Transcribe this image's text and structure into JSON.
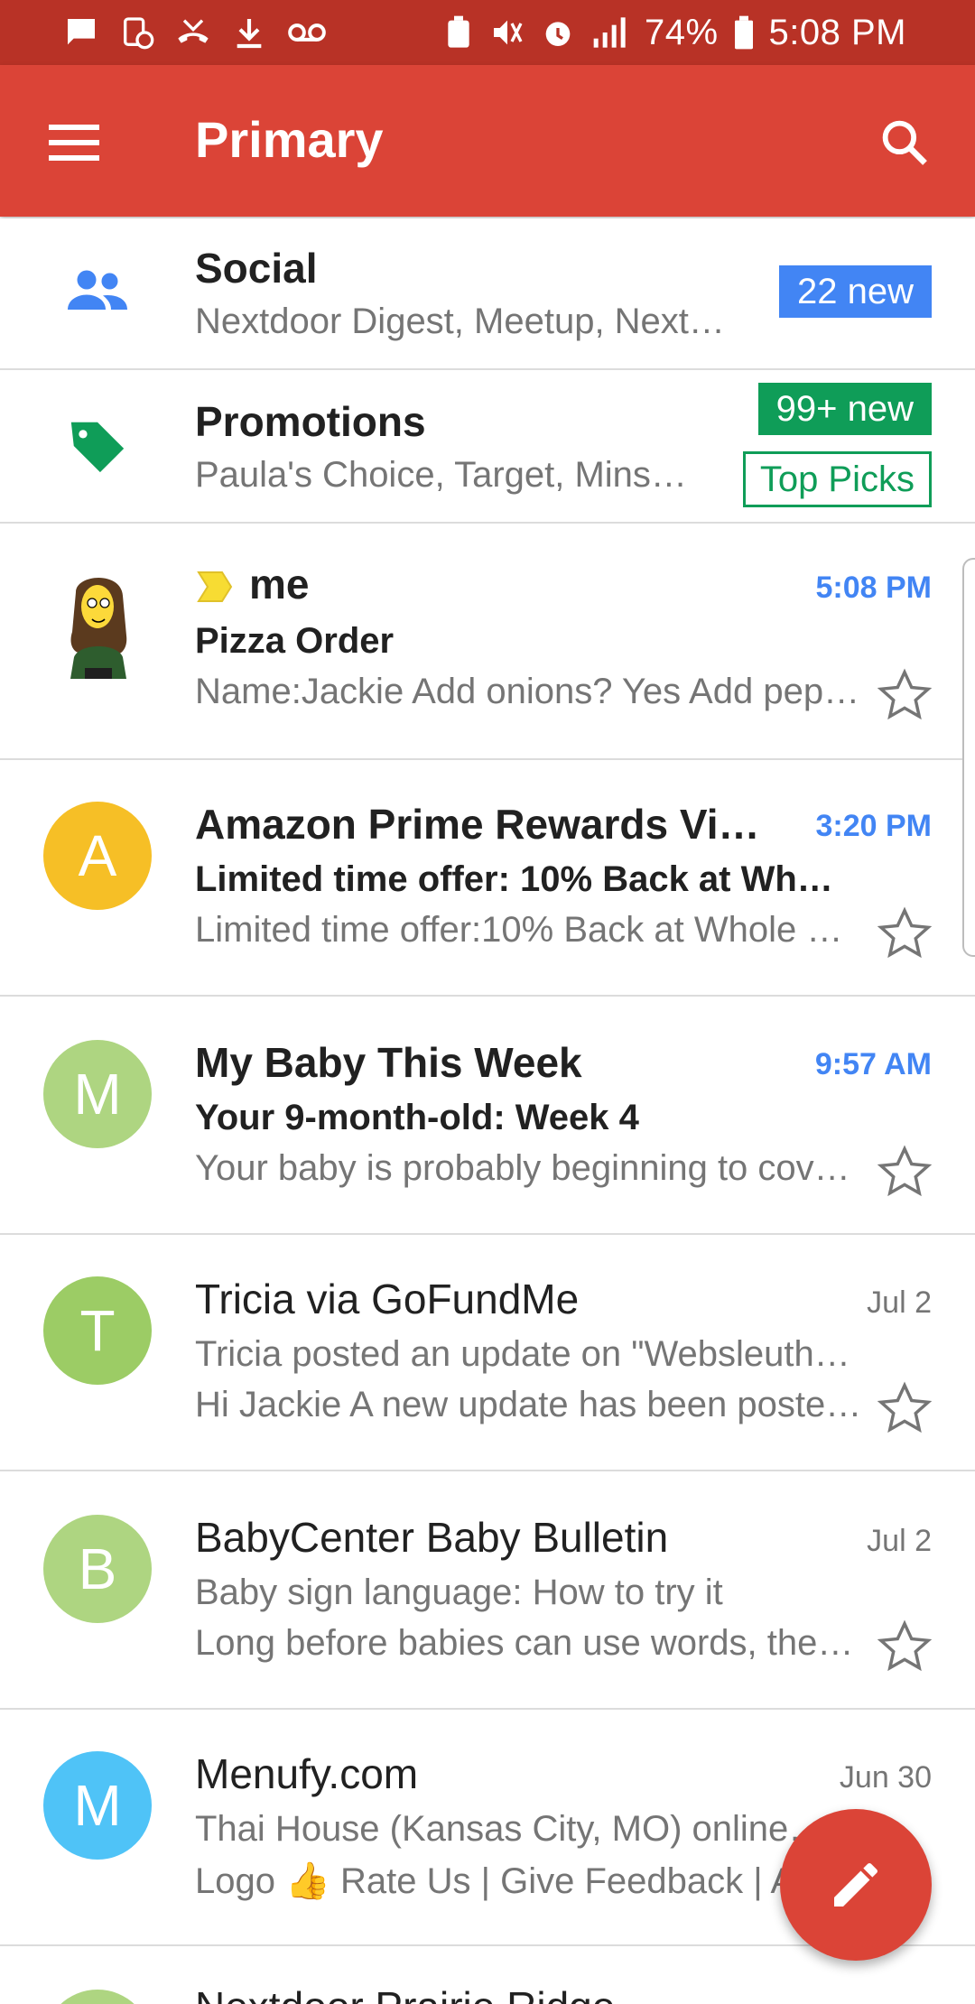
{
  "status_bar": {
    "battery": "74%",
    "time": "5:08 PM"
  },
  "app_bar": {
    "title": "Primary"
  },
  "categories": [
    {
      "name": "Social",
      "senders": "Nextdoor Digest, Meetup, Next…",
      "badge": "22 new",
      "badge_color": "#4285f4",
      "icon": "people-icon"
    },
    {
      "name": "Promotions",
      "senders": "Paula's Choice, Target, Mins…",
      "badge": "99+ new",
      "badge_color": "#0f9d58",
      "extra_badge": "Top Picks",
      "icon": "tag-icon"
    }
  ],
  "emails": [
    {
      "sender": "me",
      "subject": "Pizza Order",
      "snippet": "Name:Jackie Add onions? Yes Add pep…",
      "time": "5:08 PM",
      "unread": true,
      "important": true,
      "avatar_type": "image"
    },
    {
      "sender": "Amazon Prime Rewards Vis…",
      "subject": "Limited time offer: 10% Back at Whol…",
      "snippet": "Limited time offer:10% Back at Whole F…",
      "time": "3:20 PM",
      "unread": true,
      "avatar_letter": "A",
      "avatar_color": "#f6bf26"
    },
    {
      "sender": "My Baby This Week",
      "subject": "Your 9-month-old: Week 4",
      "snippet": "Your baby is probably beginning to cov…",
      "time": "9:57 AM",
      "unread": true,
      "avatar_letter": "M",
      "avatar_color": "#aed581"
    },
    {
      "sender": "Tricia via GoFundMe",
      "subject": "Tricia posted an update on \"Websleuth…",
      "snippet": "Hi Jackie A new update has been poste…",
      "time": "Jul 2",
      "unread": false,
      "avatar_letter": "T",
      "avatar_color": "#9ccc65"
    },
    {
      "sender": "BabyCenter Baby Bulletin",
      "subject": "Baby sign language: How to try it",
      "snippet": "Long before babies can use words, the…",
      "time": "Jul 2",
      "unread": false,
      "avatar_letter": "B",
      "avatar_color": "#aed581"
    },
    {
      "sender": "Menufy.com",
      "subject": "Thai House (Kansas City, MO) online…",
      "snippet": "Logo 👍 Rate Us | Give Feedback | A…",
      "time": "Jun 30",
      "unread": false,
      "avatar_letter": "M",
      "avatar_color": "#4fc3f7"
    }
  ],
  "partial_row": {
    "sender": "Nextdoor Prairie Ridge",
    "avatar_color": "#aed581"
  },
  "fab": {
    "icon": "pencil-icon"
  }
}
